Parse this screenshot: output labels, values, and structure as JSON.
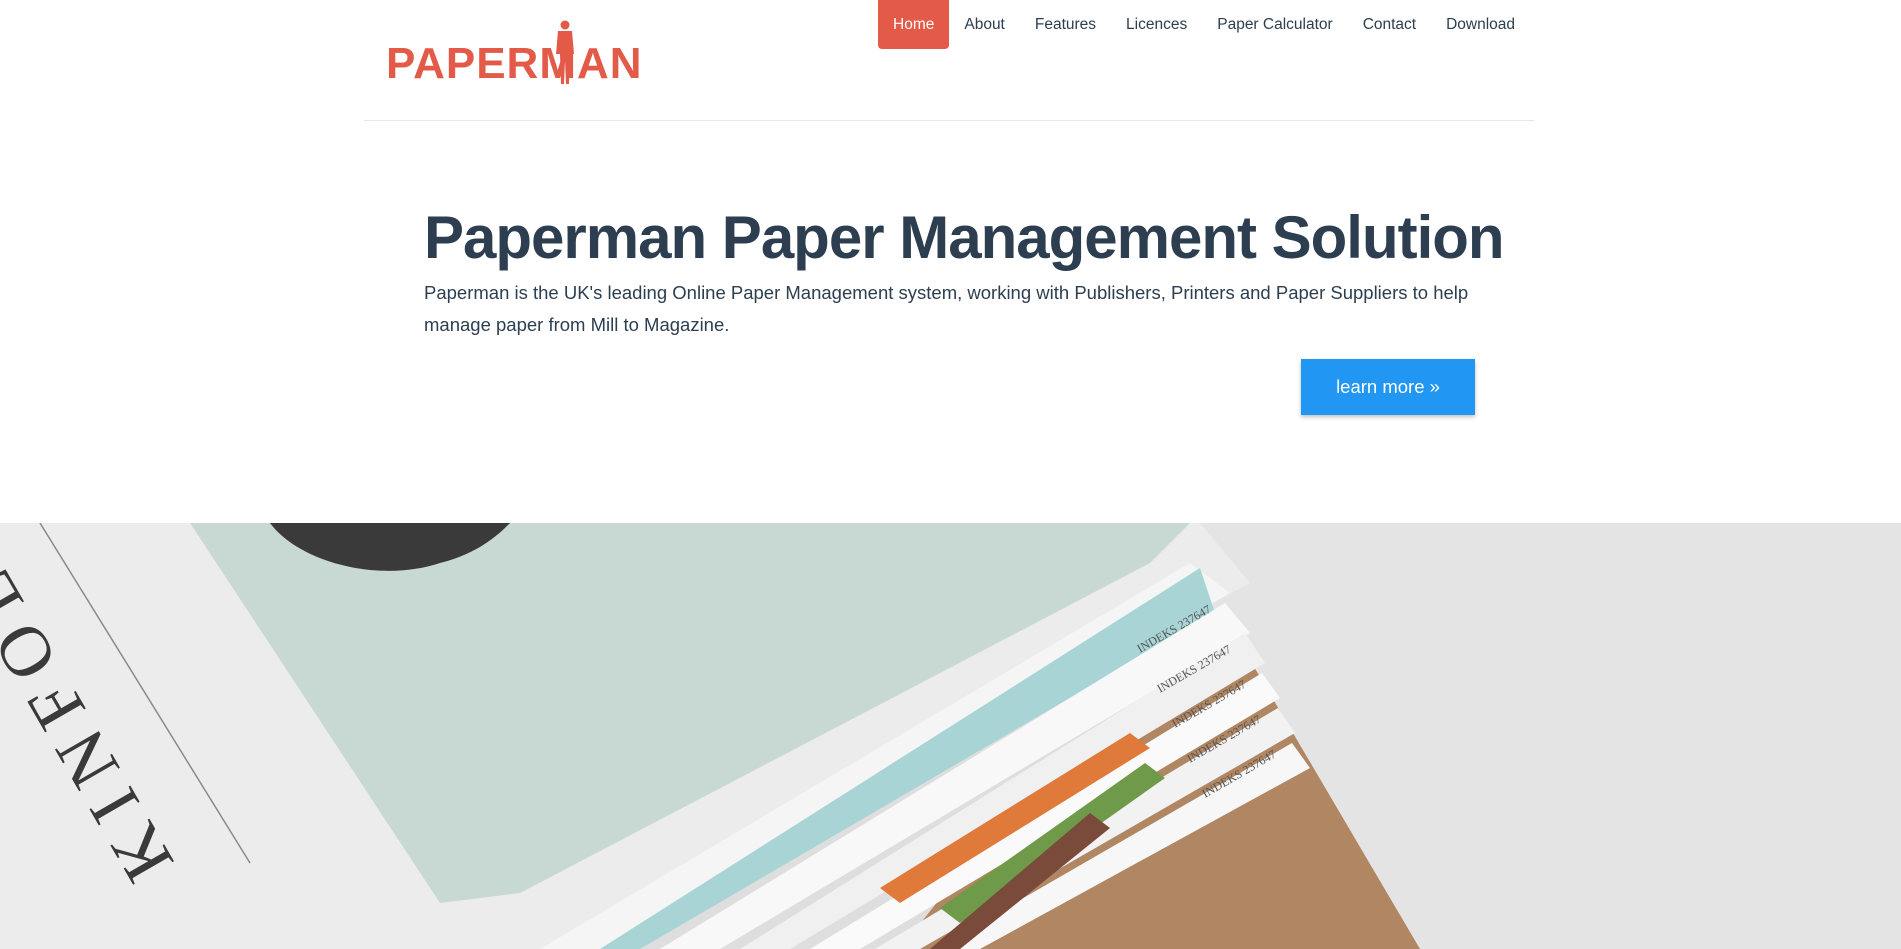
{
  "logo": {
    "text": "PAPERMAN"
  },
  "nav": {
    "items": [
      {
        "label": "Home",
        "active": true
      },
      {
        "label": "About",
        "active": false
      },
      {
        "label": "Features",
        "active": false
      },
      {
        "label": "Licences",
        "active": false
      },
      {
        "label": "Paper Calculator",
        "active": false
      },
      {
        "label": "Contact",
        "active": false
      },
      {
        "label": "Download",
        "active": false
      }
    ]
  },
  "hero": {
    "title": "Paperman Paper Management Solution",
    "text": "Paperman is the UK's leading Online Paper Management system, working with Publishers, Printers and Paper Suppliers to help manage paper from Mill to Magazine.",
    "button_label": "learn more »"
  },
  "photo": {
    "cover_word": "KINFOLK",
    "spine_labels": [
      "INDEKS 237647",
      "INDEKS 237647",
      "INDEKS 237647",
      "INDEKS 237647",
      "INDEKS 237647"
    ]
  },
  "colors": {
    "brand": "#e35a48",
    "accent": "#2196f3",
    "text": "#2c3e50"
  }
}
